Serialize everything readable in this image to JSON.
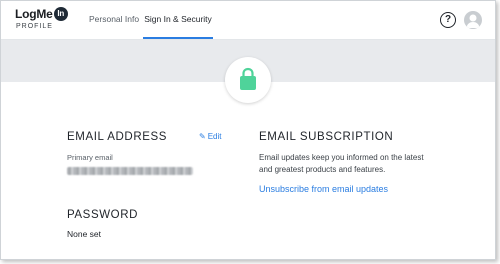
{
  "brand": {
    "logo_text": "LogMe",
    "logo_badge": "In",
    "logo_subtitle": "PROFILE"
  },
  "nav": {
    "tabs": [
      {
        "label": "Personal Info",
        "active": false
      },
      {
        "label": "Sign In & Security",
        "active": true
      }
    ],
    "help_label": "?"
  },
  "hero": {
    "icon": "lock-icon",
    "icon_color": "#4fd39a"
  },
  "email": {
    "heading": "EMAIL ADDRESS",
    "edit_label": "Edit",
    "primary_label": "Primary email",
    "primary_value": "•••••••••••••••••••••"
  },
  "password": {
    "heading": "PASSWORD",
    "value": "None set"
  },
  "subscription": {
    "heading": "EMAIL SUBSCRIPTION",
    "description": "Email updates keep you informed on the latest and greatest products and features.",
    "unsubscribe_label": "Unsubscribe from email updates"
  },
  "colors": {
    "accent": "#2a7de1",
    "banner": "#e8eaed",
    "lock": "#4fd39a"
  }
}
